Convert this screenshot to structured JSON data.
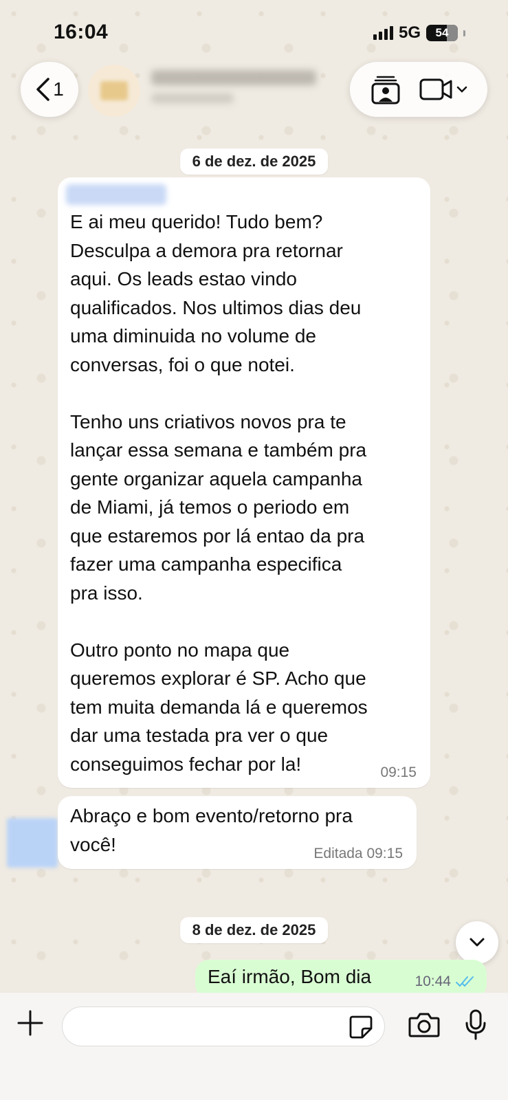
{
  "status_bar": {
    "time": "16:04",
    "network": "5G",
    "battery": "54"
  },
  "header": {
    "back_count": "1"
  },
  "dates": {
    "first": "6 de dez. de 2025",
    "second": "8 de dez. de 2025"
  },
  "messages": [
    {
      "text": "E ai meu querido! Tudo bem?\nDesculpa a demora pra retornar\naqui. Os leads estao vindo\nqualificados. Nos ultimos dias deu\numa diminuida no volume de\nconversas, foi o que notei.\n\nTenho uns criativos novos pra te\nlançar essa semana e também pra\ngente organizar aquela campanha\nde Miami, já temos o periodo em\nque estaremos por lá entao da pra\nfazer uma campanha especifica\npra isso.\n\nOutro ponto no mapa que\nqueremos explorar é SP. Acho que\ntem muita demanda lá e queremos\ndar uma testada pra ver o que\nconseguimos fechar por la!",
      "time": "09:15"
    },
    {
      "text": "Abraço e bom evento/retorno pra\nvocê!",
      "time": "Editada 09:15"
    },
    {
      "text": "Eaí irmão, Bom dia",
      "time": "10:44"
    }
  ],
  "colors": {
    "outgoing_bubble": "#d9fdd3",
    "read_ticks": "#53bdeb",
    "background": "#efeae2"
  }
}
